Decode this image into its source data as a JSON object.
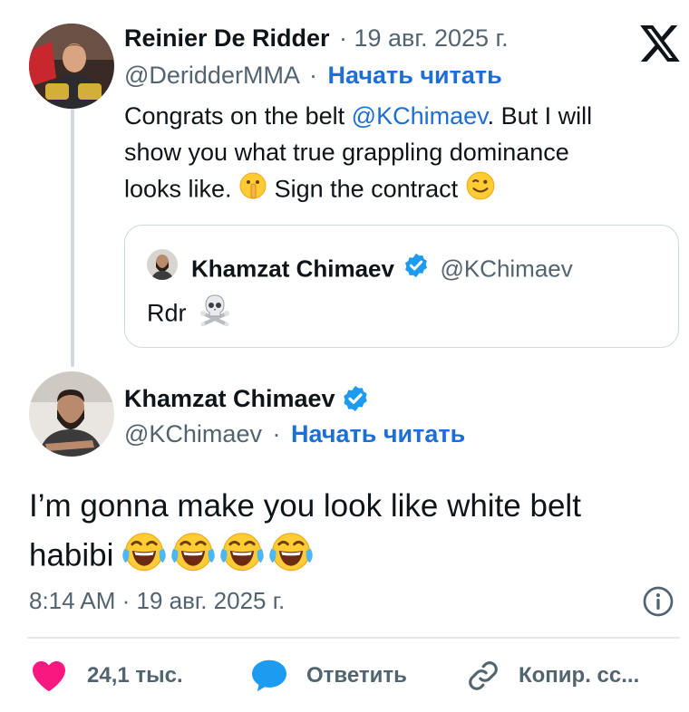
{
  "reply_tweet": {
    "author_name": "Reinier De Ridder",
    "date": "· 19 авг. 2025 г.",
    "handle": "@DeridderMMA",
    "handle_separator": "·",
    "follow_label": "Начать читать",
    "text_part1": "Congrats on the belt ",
    "mention": "@KChimaev",
    "text_part2": ". But I will",
    "text_line2": "show you what true grappling dominance",
    "text_line3a": "looks like. ",
    "text_line3b": " Sign the contract "
  },
  "quoted_tweet": {
    "author_name": "Khamzat Chimaev",
    "handle": "@KChimaev",
    "text": "Rdr"
  },
  "main_tweet": {
    "author_name": "Khamzat Chimaev",
    "handle": "@KChimaev",
    "handle_separator": "·",
    "follow_label": "Начать читать",
    "text_line1": "I’m gonna make you look like white belt",
    "text_line2": "habibi ",
    "timestamp": "8:14 AM · 19 авг. 2025 г."
  },
  "actions": {
    "likes_label": "24,1 тыс.",
    "reply_label": "Ответить",
    "copy_label": "Копир. сс..."
  },
  "icons": {
    "logo": "x-logo-icon",
    "verified": "verified-badge-icon",
    "info": "info-icon",
    "like": "heart-icon",
    "reply": "speech-bubble-icon",
    "copy": "link-icon"
  },
  "colors": {
    "accent": "#1d6fd6",
    "verified": "#1d9bf0",
    "like": "#f91880",
    "muted": "#536471"
  }
}
